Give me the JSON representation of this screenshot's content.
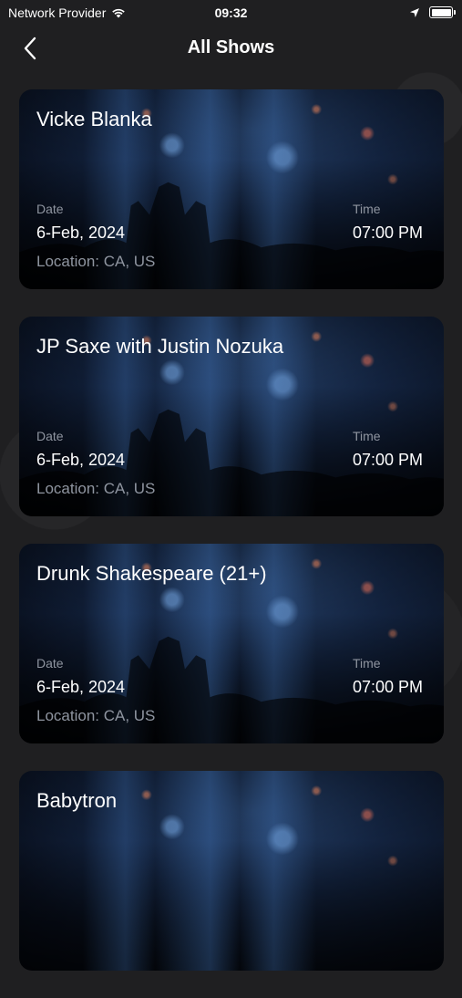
{
  "status_bar": {
    "carrier": "Network Provider",
    "time": "09:32"
  },
  "nav": {
    "title": "All Shows"
  },
  "shows": [
    {
      "title": "Vicke Blanka",
      "date_label": "Date",
      "date": "6-Feb, 2024",
      "time_label": "Time",
      "time": "07:00 PM",
      "location": "Location: CA, US"
    },
    {
      "title": "JP Saxe with Justin Nozuka",
      "date_label": "Date",
      "date": "6-Feb, 2024",
      "time_label": "Time",
      "time": "07:00 PM",
      "location": "Location: CA, US"
    },
    {
      "title": "Drunk Shakespeare (21+)",
      "date_label": "Date",
      "date": "6-Feb, 2024",
      "time_label": "Time",
      "time": "07:00 PM",
      "location": "Location: CA, US"
    },
    {
      "title": "Babytron",
      "date_label": "",
      "date": "",
      "time_label": "",
      "time": "",
      "location": ""
    }
  ],
  "colors": {
    "background": "#1f1f21",
    "label": "#8f95a0",
    "text": "#ffffff"
  }
}
